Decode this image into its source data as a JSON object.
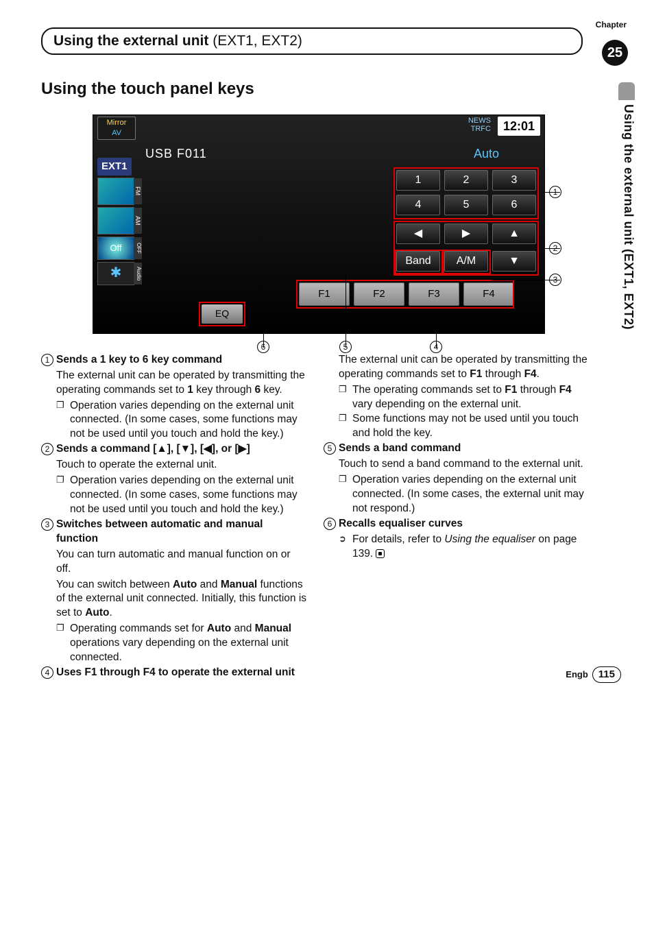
{
  "header": {
    "chapter_label": "Chapter",
    "chapter_num": "25",
    "title_main": "Using the external unit ",
    "title_sub": "(EXT1, EXT2)",
    "vertical": "Using the external unit (EXT1, EXT2)"
  },
  "section_title": "Using the touch panel keys",
  "shot": {
    "mirror_top": "Mirror",
    "mirror_bot": "AV",
    "news_top": "NEWS",
    "news_bot": "TRFC",
    "clock": "12:01",
    "usb": "USB F011",
    "auto": "Auto",
    "ext1": "EXT1",
    "tab_fm": "FM",
    "tab_am": "AM",
    "off": "Off",
    "tab_off": "OFF",
    "tab_audio": "Audio",
    "keys": [
      "1",
      "2",
      "3",
      "4",
      "5",
      "6"
    ],
    "arrows": [
      "◀",
      "▶",
      "▲"
    ],
    "band": "Band",
    "am_key": "A/M",
    "down": "▼",
    "f": [
      "F1",
      "F2",
      "F3",
      "F4"
    ],
    "eq": "EQ"
  },
  "callouts": {
    "c1": "1",
    "c2": "2",
    "c3": "3",
    "c4": "4",
    "c5": "5",
    "c6": "6"
  },
  "body": {
    "i1_title": "Sends a 1 key to 6 key command",
    "i1_p": "The external unit can be operated by transmitting the operating commands set to ",
    "i1_b1": "1",
    "i1_p2": " key through ",
    "i1_b2": "6",
    "i1_p3": " key.",
    "i1_s1": "Operation varies depending on the external unit connected. (In some cases, some functions may not be used until you touch and hold the key.)",
    "i2_title_a": "Sends a command ",
    "i2_title_b": "[▲], [▼], [◀], or [▶]",
    "i2_p": "Touch to operate the external unit.",
    "i2_s1": "Operation varies depending on the external unit connected. (In some cases, some functions may not be used until you touch and hold the key.)",
    "i3_title": "Switches between automatic and manual function",
    "i3_p1": "You can turn automatic and manual function on or off.",
    "i3_p2a": "You can switch between ",
    "i3_p2b": "Auto",
    "i3_p2c": " and ",
    "i3_p2d": "Manual",
    "i3_p2e": " functions of the external unit connected. Initially, this function is set to ",
    "i3_p2f": "Auto",
    "i3_p2g": ".",
    "i3_s1a": "Operating commands set for ",
    "i3_s1b": "Auto",
    "i3_s1c": " and ",
    "i3_s1d": "Manual",
    "i3_s1e": " operations vary depending on the external unit connected.",
    "i4_title": "Uses F1 through F4 to operate the external unit",
    "i4_p1a": "The external unit can be operated by transmitting the operating commands set to ",
    "i4_p1b": "F1",
    "i4_p1c": " through ",
    "i4_p1d": "F4",
    "i4_p1e": ".",
    "i4_s1a": "The operating commands set to ",
    "i4_s1b": "F1",
    "i4_s1c": " through ",
    "i4_s1d": "F4",
    "i4_s1e": " vary depending on the external unit.",
    "i4_s2": "Some functions may not be used until you touch and hold the key.",
    "i5_title": "Sends a band command",
    "i5_p": "Touch to send a band command to the external unit.",
    "i5_s1": "Operation varies depending on the external unit connected. (In some cases, the external unit may not respond.)",
    "i6_title": "Recalls equaliser curves",
    "i6_s1a": "For details, refer to ",
    "i6_s1b": "Using the equaliser",
    "i6_s1c": " on page 139."
  },
  "footer": {
    "lang": "Engb",
    "page": "115"
  }
}
